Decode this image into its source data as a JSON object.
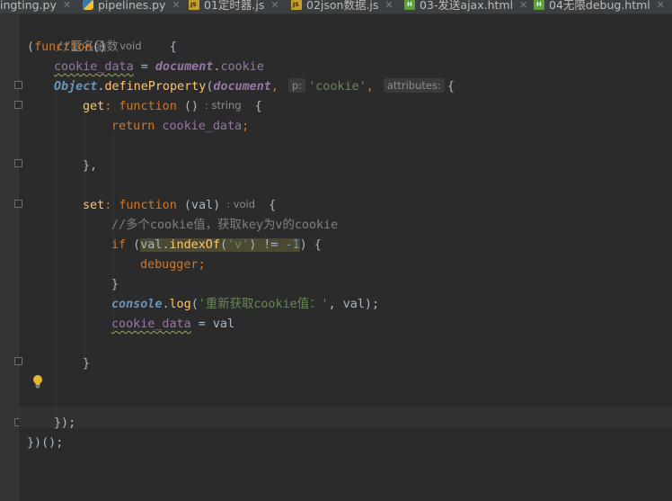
{
  "tabs": [
    {
      "label": "ingting.py",
      "icon": "python-file-icon"
    },
    {
      "label": "pipelines.py",
      "icon": "python-file-icon"
    },
    {
      "label": "01定时器.js",
      "icon": "js-file-icon"
    },
    {
      "label": "02json数据.js",
      "icon": "js-file-icon"
    },
    {
      "label": "03-发送ajax.html",
      "icon": "html-file-icon"
    },
    {
      "label": "04无限debug.html",
      "icon": "html-file-icon"
    }
  ],
  "code": {
    "l1_comment": "//匿名函数",
    "l2_paren": "(",
    "l2_kw": "function",
    "l2_parens": "()",
    "l2_hint": ": void",
    "l2_brace": "{",
    "l3_var": "cookie_data",
    "l3_eq": " = ",
    "l3_doc": "document",
    "l3_dot": ".",
    "l3_prop": "cookie",
    "l4_obj": "Object",
    "l4_dot": ".",
    "l4_method": "defineProperty",
    "l4_open": "(",
    "l4_doc": "document",
    "l4_comma": ",",
    "l4_hint_p": "p:",
    "l4_str": "'cookie'",
    "l4_comma2": ",",
    "l4_hint_attr": "attributes:",
    "l4_brace": "{",
    "l5_get": "get",
    "l5_colon": ":",
    "l5_kw": "function",
    "l5_parens": " ()",
    "l5_hint": ": string",
    "l5_brace": "{",
    "l6_kw": "return",
    "l6_var": " cookie_data",
    "l6_semi": ";",
    "l8_close": "},",
    "l10_set": "set",
    "l10_colon": ":",
    "l10_kw": "function",
    "l10_params": " (val)",
    "l10_hint": ": void",
    "l10_brace": "{",
    "l11_comment": "//多个cookie值，获取key为v的cookie",
    "l12_kw": "if",
    "l12_open": " (",
    "l12_var": "val",
    "l12_dot": ".",
    "l12_method": "indexOf",
    "l12_p1": "(",
    "l12_str": "'v'",
    "l12_p2": ")",
    "l12_op": " != ",
    "l12_num": "-1",
    "l12_close": ") {",
    "l13_kw": "debugger",
    "l13_semi": ";",
    "l14_close": "}",
    "l15_obj": "console",
    "l15_dot": ".",
    "l15_method": "log",
    "l15_open": "(",
    "l15_str": "'重新获取cookie值：'",
    "l15_rest": ", val);",
    "l16_var": "cookie_data",
    "l16_rest": " = val",
    "l18_close": "}",
    "l21_close": "});",
    "l22_close": "})();"
  }
}
